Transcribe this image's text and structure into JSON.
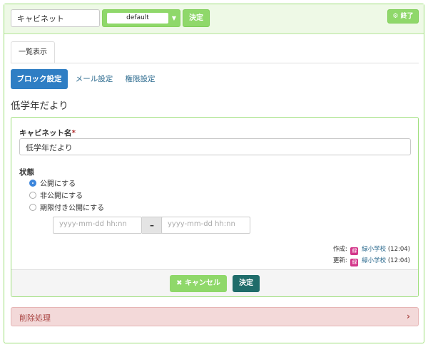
{
  "topbar": {
    "plugin_name": "キャビネット",
    "frame_style": "default",
    "frame_ok_label": "決定",
    "finish_label": "終了"
  },
  "tabs": [
    {
      "label": "一覧表示"
    }
  ],
  "pills": [
    {
      "label": "ブロック設定",
      "active": true
    },
    {
      "label": "メール設定",
      "active": false
    },
    {
      "label": "権限設定",
      "active": false
    }
  ],
  "block_title": "低学年だより",
  "form": {
    "name_label": "キャビネット名",
    "required_mark": "*",
    "name_value": "低学年だより",
    "status_label": "状態",
    "status_options": [
      {
        "label": "公開にする",
        "checked": true
      },
      {
        "label": "非公開にする",
        "checked": false
      },
      {
        "label": "期限付き公開にする",
        "checked": false
      }
    ],
    "start_placeholder": "yyyy-mm-dd hh:nn",
    "end_placeholder": "yyyy-mm-dd hh:nn",
    "date_separator": "–",
    "created_label": "作成:",
    "updated_label": "更新:",
    "user_badge": "緑",
    "user_name": "緑小学校",
    "created_time": "(12:04)",
    "updated_time": "(12:04)",
    "cancel_label": "キャンセル",
    "submit_label": "決定"
  },
  "delete_section": {
    "label": "削除処理"
  },
  "colors": {
    "accent_green": "#8fd86a",
    "primary_blue": "#2f7ec4",
    "submit_teal": "#1f6c6a",
    "danger_bg": "#f3d9d9",
    "danger_text": "#a94442"
  }
}
